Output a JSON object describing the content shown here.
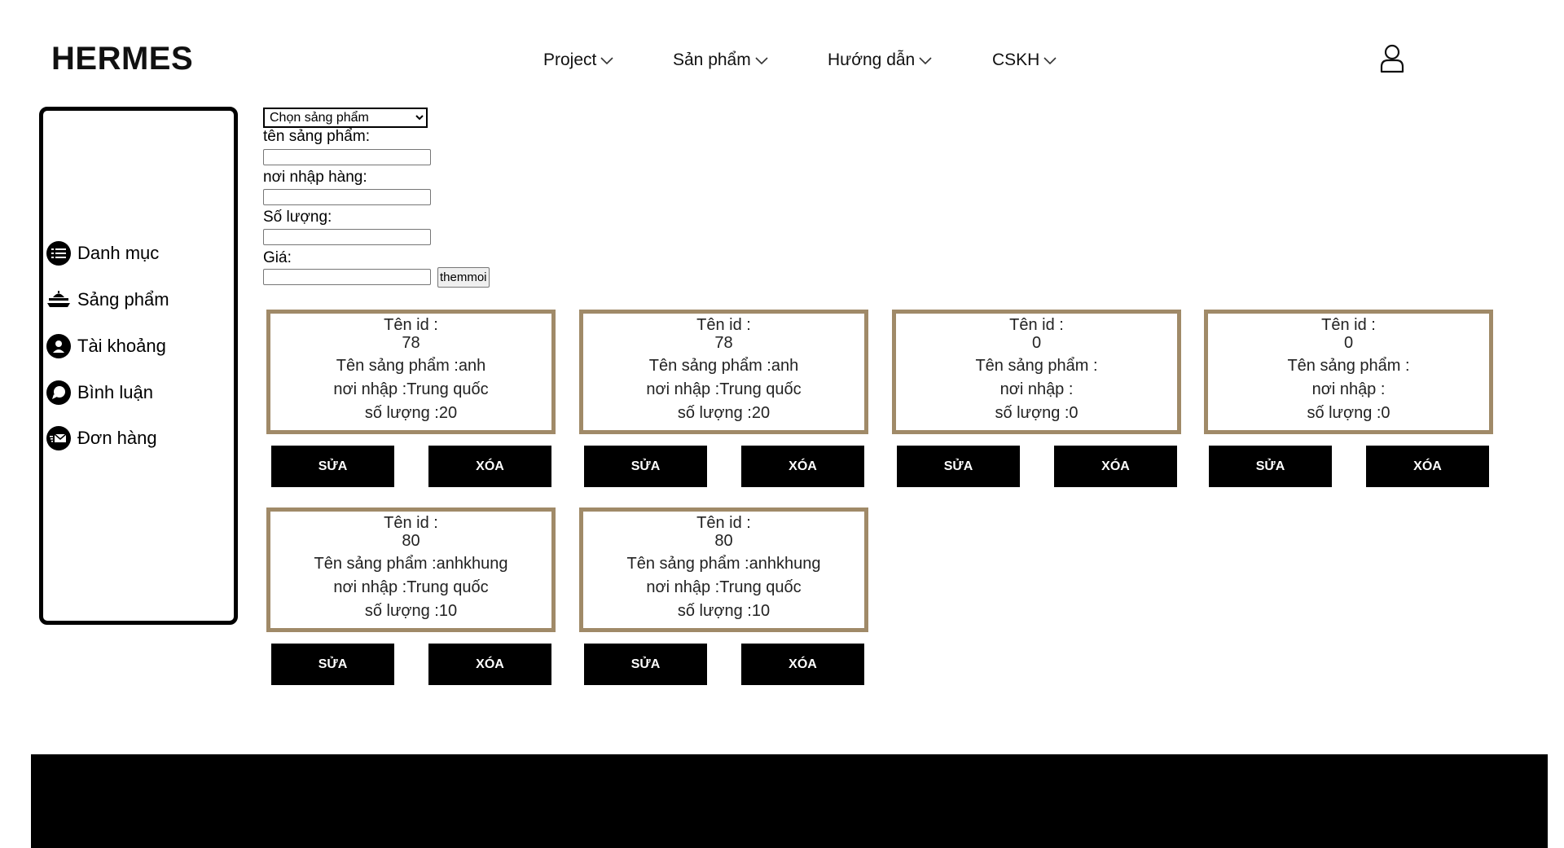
{
  "header": {
    "logo": "HERMES",
    "nav": [
      {
        "label": "Project"
      },
      {
        "label": "Sản phẩm"
      },
      {
        "label": "Hướng dẫn"
      },
      {
        "label": "CSKH"
      }
    ],
    "user_icon": "user-icon"
  },
  "sidebar": {
    "items": [
      {
        "label": "Danh mục",
        "icon": "list-icon"
      },
      {
        "label": "Sảng phẩm",
        "icon": "product-tray-icon"
      },
      {
        "label": "Tài khoảng",
        "icon": "account-icon"
      },
      {
        "label": "Bình luận",
        "icon": "comment-icon"
      },
      {
        "label": "Đơn hàng",
        "icon": "order-mail-icon"
      }
    ]
  },
  "form": {
    "select_value": "Chọn sảng phẩm",
    "name_label": "tên sảng phẩm:",
    "name_value": "",
    "origin_label": "nơi nhập hàng:",
    "origin_value": "",
    "quantity_label": "Số lượng:",
    "quantity_value": "",
    "price_label": "Giá:",
    "price_value": "",
    "add_button": "themmoi"
  },
  "cards": [
    {
      "id_label": "Tên id :",
      "id": "78",
      "name_line": "Tên sảng phẩm :anh",
      "origin_line": "nơi nhập :Trung quốc",
      "qty_line": "số lượng :20",
      "edit": "SỬA",
      "delete": "XÓA"
    },
    {
      "id_label": "Tên id :",
      "id": "78",
      "name_line": "Tên sảng phẩm :anh",
      "origin_line": "nơi nhập :Trung quốc",
      "qty_line": "số lượng :20",
      "edit": "SỬA",
      "delete": "XÓA"
    },
    {
      "id_label": "Tên id :",
      "id": "0",
      "name_line": "Tên sảng phẩm :",
      "origin_line": "nơi nhập :",
      "qty_line": "số lượng :0",
      "edit": "SỬA",
      "delete": "XÓA"
    },
    {
      "id_label": "Tên id :",
      "id": "0",
      "name_line": "Tên sảng phẩm :",
      "origin_line": "nơi nhập :",
      "qty_line": "số lượng :0",
      "edit": "SỬA",
      "delete": "XÓA"
    },
    {
      "id_label": "Tên id :",
      "id": "80",
      "name_line": "Tên sảng phẩm :anhkhung",
      "origin_line": "nơi nhập :Trung quốc",
      "qty_line": "số lượng :10",
      "edit": "SỬA",
      "delete": "XÓA"
    },
    {
      "id_label": "Tên id :",
      "id": "80",
      "name_line": "Tên sảng phẩm :anhkhung",
      "origin_line": "nơi nhập :Trung quốc",
      "qty_line": "số lượng :10",
      "edit": "SỬA",
      "delete": "XÓA"
    }
  ],
  "colors": {
    "card_border": "#a08a68",
    "button_bg": "#000000",
    "footer_bg": "#000000"
  }
}
